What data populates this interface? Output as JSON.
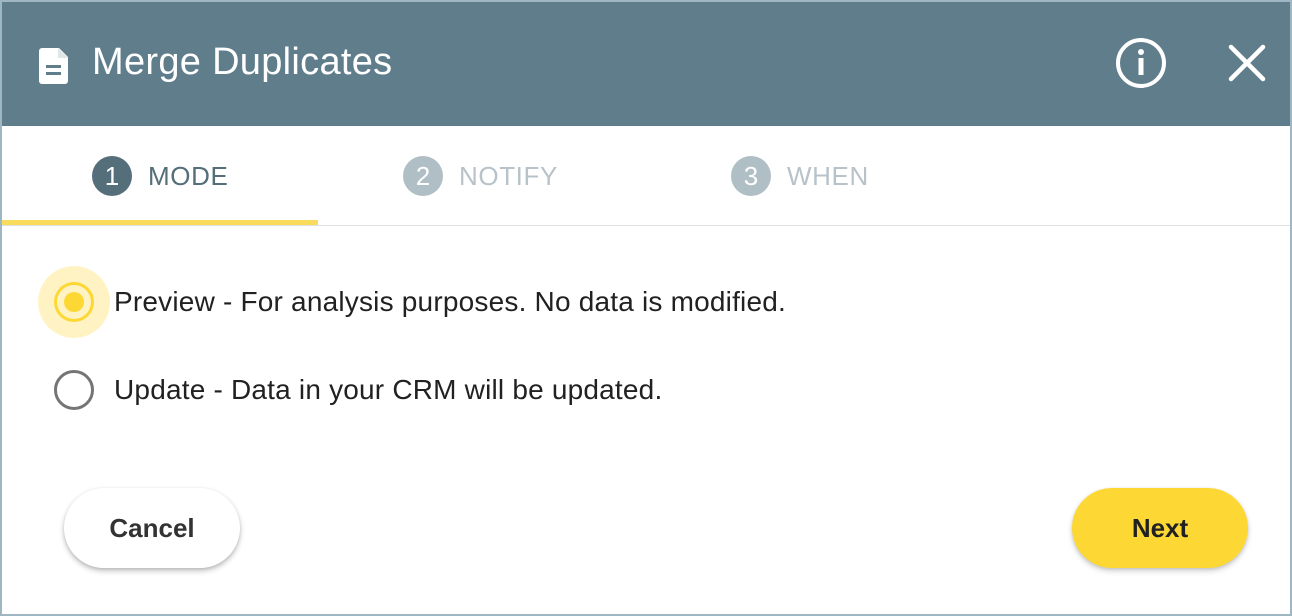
{
  "dialog": {
    "title": "Merge Duplicates",
    "icons": {
      "title_icon": "document-icon",
      "info_icon": "info-icon",
      "close_icon": "close-icon"
    }
  },
  "steps": [
    {
      "number": "1",
      "label": "MODE",
      "active": true
    },
    {
      "number": "2",
      "label": "NOTIFY",
      "active": false
    },
    {
      "number": "3",
      "label": "WHEN",
      "active": false
    }
  ],
  "options": [
    {
      "label": "Preview - For analysis purposes. No data is modified.",
      "selected": true
    },
    {
      "label": "Update - Data in your CRM will be updated.",
      "selected": false
    }
  ],
  "buttons": {
    "cancel": "Cancel",
    "next": "Next"
  },
  "colors": {
    "header_bg": "#607d8b",
    "accent_yellow": "#fdd835",
    "active_step": "#546e7a",
    "inactive_step": "#b0bec5"
  }
}
